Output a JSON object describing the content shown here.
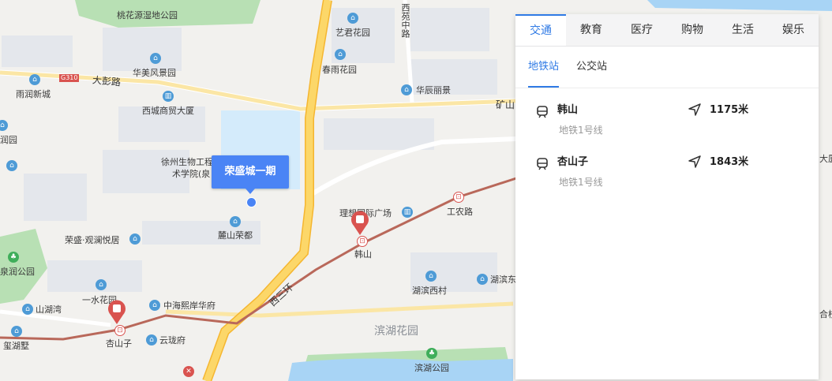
{
  "map": {
    "roads": [
      "大彭路",
      "西三环",
      "矿山",
      "西苑中路",
      "工农路"
    ],
    "road_badge": "G310",
    "pois": [
      {
        "name": "桃花源湿地公园",
        "icon": "park-icon"
      },
      {
        "name": "艺君花园",
        "icon": "residential-icon"
      },
      {
        "name": "华美风景园",
        "icon": "residential-icon"
      },
      {
        "name": "春雨花园",
        "icon": "residential-icon"
      },
      {
        "name": "雨润新城",
        "icon": "residential-icon"
      },
      {
        "name": "华辰丽景",
        "icon": "residential-icon"
      },
      {
        "name": "西城商贸大厦",
        "icon": "building-icon"
      },
      {
        "name": "润园",
        "icon": "residential-icon"
      },
      {
        "name": "徐州生物工程",
        "icon": "school-icon"
      },
      {
        "name": "术学院(泉",
        "icon": "school-icon"
      },
      {
        "name": "理想国际广场",
        "icon": "building-icon"
      },
      {
        "name": "工农路",
        "icon": "metro-icon"
      },
      {
        "name": "荣盛·观澜悦居",
        "icon": "residential-icon"
      },
      {
        "name": "麓山荣都",
        "icon": "residential-icon"
      },
      {
        "name": "韩山",
        "icon": "metro-icon"
      },
      {
        "name": "泉润公园",
        "icon": "park-icon"
      },
      {
        "name": "一水花园",
        "icon": "residential-icon"
      },
      {
        "name": "湖滨西村",
        "icon": "residential-icon"
      },
      {
        "name": "湖滨东",
        "icon": "residential-icon"
      },
      {
        "name": "山湖湾",
        "icon": "residential-icon"
      },
      {
        "name": "中海熙岸华府",
        "icon": "residential-icon"
      },
      {
        "name": "杏山子",
        "icon": "metro-icon"
      },
      {
        "name": "云珑府",
        "icon": "residential-icon"
      },
      {
        "name": "玺湖墅",
        "icon": "residential-icon"
      },
      {
        "name": "滨湖花园",
        "icon": "district"
      },
      {
        "name": "滨湖公园",
        "icon": "park-icon"
      },
      {
        "name": "大厦",
        "icon": "building-icon"
      },
      {
        "name": "合校",
        "icon": "school-icon"
      }
    ],
    "marker_title": "荣盛城一期"
  },
  "panel": {
    "categories": [
      "交通",
      "教育",
      "医疗",
      "购物",
      "生活",
      "娱乐"
    ],
    "active_category": "交通",
    "subtabs": [
      "地铁站",
      "公交站"
    ],
    "active_subtab": "地铁站",
    "stations": [
      {
        "name": "韩山",
        "line": "地铁1号线",
        "distance": "1175米"
      },
      {
        "name": "杏山子",
        "line": "地铁1号线",
        "distance": "1843米"
      }
    ]
  },
  "colors": {
    "accent": "#2f7ae5",
    "marker": "#4a84f5",
    "metro": "#d9534f",
    "major_road": "#f7c74a",
    "water": "#a8d4f5",
    "park": "#b8e0b4"
  }
}
